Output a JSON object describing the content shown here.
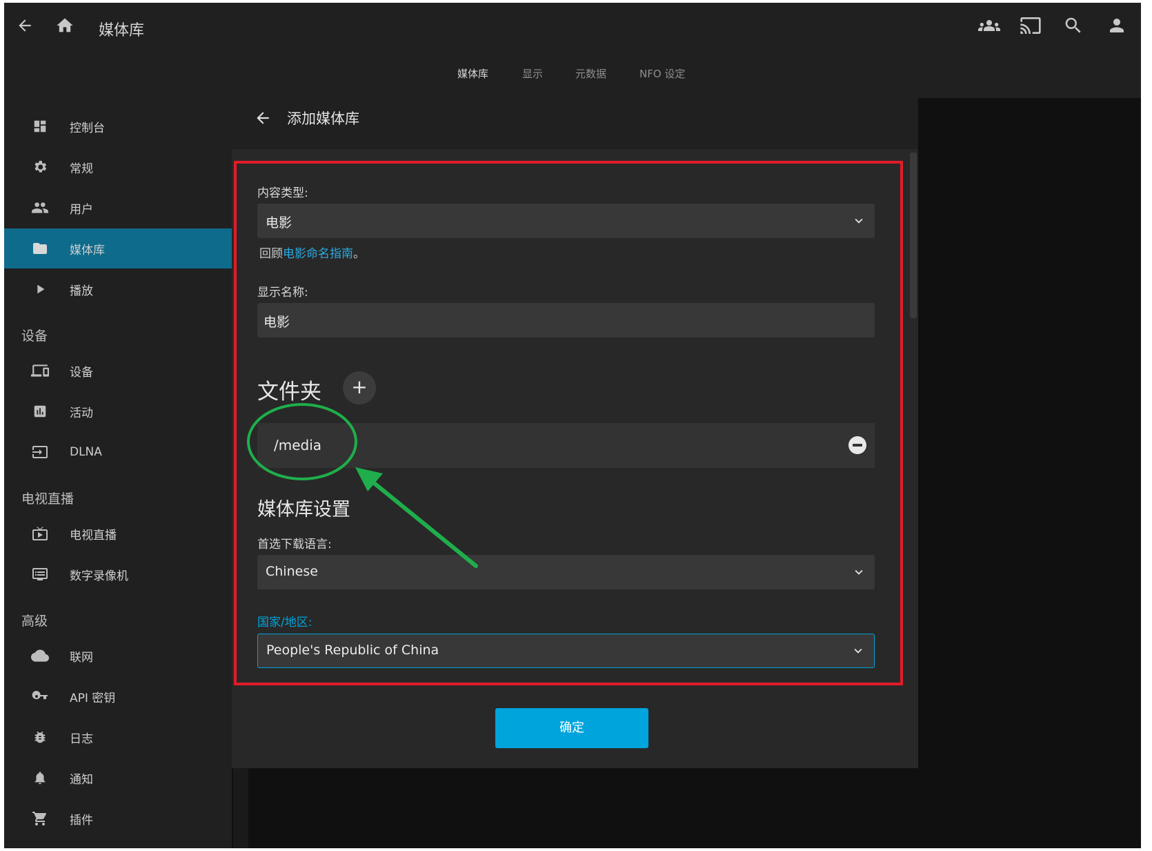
{
  "header": {
    "page_title": "媒体库",
    "tabs": [
      "媒体库",
      "显示",
      "元数据",
      "NFO 设定"
    ],
    "active_tab": "媒体库"
  },
  "sidebar": {
    "items_top": [
      {
        "label": "控制台",
        "icon": "dashboard-icon"
      },
      {
        "label": "常规",
        "icon": "gear-icon"
      },
      {
        "label": "用户",
        "icon": "users-icon"
      },
      {
        "label": "媒体库",
        "icon": "folder-icon",
        "active": true
      },
      {
        "label": "播放",
        "icon": "play-icon"
      }
    ],
    "section_devices": "设备",
    "items_devices": [
      {
        "label": "设备",
        "icon": "devices-icon"
      },
      {
        "label": "活动",
        "icon": "activity-icon"
      },
      {
        "label": "DLNA",
        "icon": "dlna-icon"
      }
    ],
    "section_livetv": "电视直播",
    "items_livetv": [
      {
        "label": "电视直播",
        "icon": "live-tv-icon"
      },
      {
        "label": "数字录像机",
        "icon": "dvr-icon"
      }
    ],
    "section_advanced": "高级",
    "items_advanced": [
      {
        "label": "联网",
        "icon": "cloud-icon"
      },
      {
        "label": "API 密钥",
        "icon": "key-icon"
      },
      {
        "label": "日志",
        "icon": "bug-icon"
      },
      {
        "label": "通知",
        "icon": "bell-icon"
      },
      {
        "label": "插件",
        "icon": "cart-icon"
      }
    ]
  },
  "dialog": {
    "title": "添加媒体库",
    "content_type_label": "内容类型:",
    "content_type_value": "电影",
    "hint_prefix": "回顾",
    "hint_link": "电影命名指南",
    "hint_suffix": "。",
    "display_name_label": "显示名称:",
    "display_name_value": "电影",
    "folders_heading": "文件夹",
    "add_folder_symbol": "+",
    "folder_path": "/media",
    "library_settings_heading": "媒体库设置",
    "language_label": "首选下载语言:",
    "language_value": "Chinese",
    "country_label": "国家/地区:",
    "country_value": "People's Republic of China",
    "ok_label": "确定"
  },
  "colors": {
    "accent": "#00a4dc",
    "annotation_red": "#e21b2a",
    "annotation_green": "#1fae4b"
  }
}
